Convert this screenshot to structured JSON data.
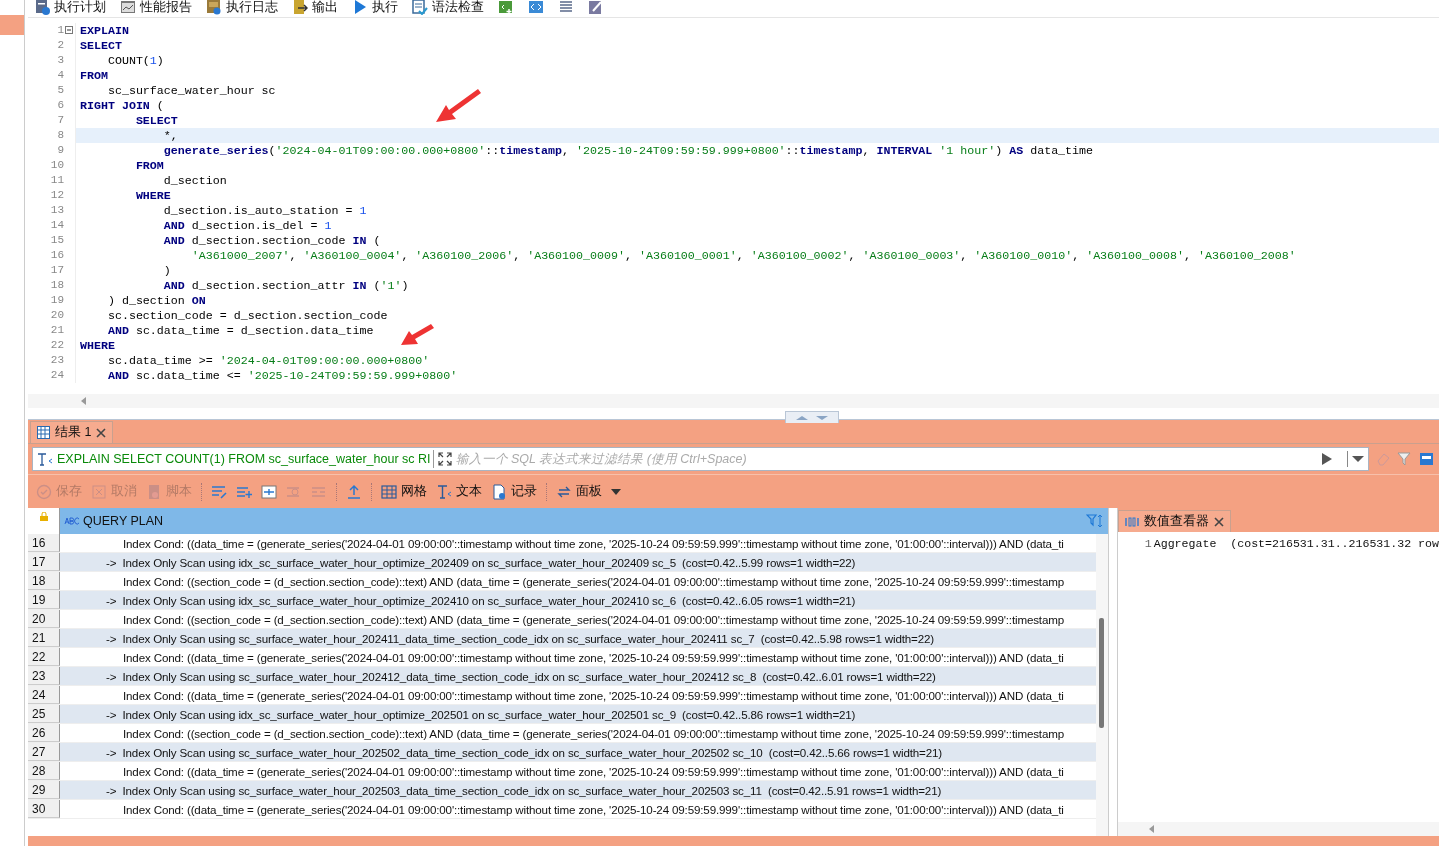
{
  "toolbar": [
    {
      "kind": "button",
      "label": "执行计划"
    },
    {
      "kind": "button",
      "label": "性能报告"
    },
    {
      "kind": "button",
      "label": "执行日志"
    },
    {
      "kind": "button",
      "label": "输出"
    },
    {
      "kind": "button",
      "label": "执行"
    },
    {
      "kind": "button",
      "label": "语法检查"
    },
    {
      "kind": "icon"
    },
    {
      "kind": "icon"
    },
    {
      "kind": "icon"
    },
    {
      "kind": "icon"
    }
  ],
  "editor": {
    "lines": [
      {
        "n": "1",
        "fold": true,
        "current": false,
        "seg": [
          {
            "kind": "keyword",
            "text": "EXPLAIN"
          }
        ]
      },
      {
        "n": "2",
        "fold": false,
        "current": false,
        "seg": [
          {
            "kind": "keyword",
            "text": "SELECT"
          }
        ]
      },
      {
        "n": "3",
        "fold": false,
        "current": false,
        "seg": [
          {
            "kind": "plain",
            "text": "    COUNT("
          },
          {
            "kind": "number",
            "text": "1"
          },
          {
            "kind": "plain",
            "text": ")"
          }
        ]
      },
      {
        "n": "4",
        "fold": false,
        "current": false,
        "seg": [
          {
            "kind": "keyword",
            "text": "FROM"
          }
        ]
      },
      {
        "n": "5",
        "fold": false,
        "current": false,
        "seg": [
          {
            "kind": "plain",
            "text": "    sc_surface_water_hour sc"
          }
        ]
      },
      {
        "n": "6",
        "fold": false,
        "current": false,
        "seg": [
          {
            "kind": "keyword",
            "text": "RIGHT JOIN"
          },
          {
            "kind": "plain",
            "text": " ("
          }
        ]
      },
      {
        "n": "7",
        "fold": false,
        "current": false,
        "seg": [
          {
            "kind": "keyword",
            "text": "        SELECT"
          }
        ]
      },
      {
        "n": "8",
        "fold": false,
        "current": true,
        "seg": [
          {
            "kind": "plain",
            "text": "            *,"
          }
        ]
      },
      {
        "n": "9",
        "fold": false,
        "current": false,
        "seg": [
          {
            "kind": "keyword",
            "text": "            generate_series"
          },
          {
            "kind": "plain",
            "text": "("
          },
          {
            "kind": "string",
            "text": "'2024-04-01T09:00:00.000+0800'"
          },
          {
            "kind": "plain",
            "text": "::"
          },
          {
            "kind": "keyword",
            "text": "timestamp"
          },
          {
            "kind": "plain",
            "text": ", "
          },
          {
            "kind": "string",
            "text": "'2025-10-24T09:59:59.999+0800'"
          },
          {
            "kind": "plain",
            "text": "::"
          },
          {
            "kind": "keyword",
            "text": "timestamp"
          },
          {
            "kind": "plain",
            "text": ", "
          },
          {
            "kind": "keyword",
            "text": "INTERVAL"
          },
          {
            "kind": "string",
            "text": " '1 hour'"
          },
          {
            "kind": "plain",
            "text": ") "
          },
          {
            "kind": "keyword",
            "text": "AS"
          },
          {
            "kind": "plain",
            "text": " data_time"
          }
        ]
      },
      {
        "n": "10",
        "fold": false,
        "current": false,
        "seg": [
          {
            "kind": "keyword",
            "text": "        FROM"
          }
        ]
      },
      {
        "n": "11",
        "fold": false,
        "current": false,
        "seg": [
          {
            "kind": "plain",
            "text": "            d_section"
          }
        ]
      },
      {
        "n": "12",
        "fold": false,
        "current": false,
        "seg": [
          {
            "kind": "keyword",
            "text": "        WHERE"
          }
        ]
      },
      {
        "n": "13",
        "fold": false,
        "current": false,
        "seg": [
          {
            "kind": "plain",
            "text": "            d_section.is_auto_station = "
          },
          {
            "kind": "number",
            "text": "1"
          }
        ]
      },
      {
        "n": "14",
        "fold": false,
        "current": false,
        "seg": [
          {
            "kind": "keyword",
            "text": "            AND"
          },
          {
            "kind": "plain",
            "text": " d_section.is_del = "
          },
          {
            "kind": "number",
            "text": "1"
          }
        ]
      },
      {
        "n": "15",
        "fold": false,
        "current": false,
        "seg": [
          {
            "kind": "keyword",
            "text": "            AND"
          },
          {
            "kind": "plain",
            "text": " d_section.section_code "
          },
          {
            "kind": "keyword",
            "text": "IN"
          },
          {
            "kind": "plain",
            "text": " ("
          }
        ]
      },
      {
        "n": "16",
        "fold": false,
        "current": false,
        "seg": [
          {
            "kind": "string",
            "text": "                'A361000_2007'"
          },
          {
            "kind": "plain",
            "text": ", "
          },
          {
            "kind": "string",
            "text": "'A360100_0004'"
          },
          {
            "kind": "plain",
            "text": ", "
          },
          {
            "kind": "string",
            "text": "'A360100_2006'"
          },
          {
            "kind": "plain",
            "text": ", "
          },
          {
            "kind": "string",
            "text": "'A360100_0009'"
          },
          {
            "kind": "plain",
            "text": ", "
          },
          {
            "kind": "string",
            "text": "'A360100_0001'"
          },
          {
            "kind": "plain",
            "text": ", "
          },
          {
            "kind": "string",
            "text": "'A360100_0002'"
          },
          {
            "kind": "plain",
            "text": ", "
          },
          {
            "kind": "string",
            "text": "'A360100_0003'"
          },
          {
            "kind": "plain",
            "text": ", "
          },
          {
            "kind": "string",
            "text": "'A360100_0010'"
          },
          {
            "kind": "plain",
            "text": ", "
          },
          {
            "kind": "string",
            "text": "'A360100_0008'"
          },
          {
            "kind": "plain",
            "text": ", "
          },
          {
            "kind": "string",
            "text": "'A360100_2008'"
          }
        ]
      },
      {
        "n": "17",
        "fold": false,
        "current": false,
        "seg": [
          {
            "kind": "plain",
            "text": "            )"
          }
        ]
      },
      {
        "n": "18",
        "fold": false,
        "current": false,
        "seg": [
          {
            "kind": "keyword",
            "text": "            AND"
          },
          {
            "kind": "plain",
            "text": " d_section.section_attr "
          },
          {
            "kind": "keyword",
            "text": "IN"
          },
          {
            "kind": "plain",
            "text": " ("
          },
          {
            "kind": "string",
            "text": "'1'"
          },
          {
            "kind": "plain",
            "text": ")"
          }
        ]
      },
      {
        "n": "19",
        "fold": false,
        "current": false,
        "seg": [
          {
            "kind": "plain",
            "text": "    ) d_section "
          },
          {
            "kind": "keyword",
            "text": "ON"
          }
        ]
      },
      {
        "n": "20",
        "fold": false,
        "current": false,
        "seg": [
          {
            "kind": "plain",
            "text": "    sc.section_code = d_section.section_code"
          }
        ]
      },
      {
        "n": "21",
        "fold": false,
        "current": false,
        "seg": [
          {
            "kind": "keyword",
            "text": "    AND"
          },
          {
            "kind": "plain",
            "text": " sc.data_time = d_section.data_time"
          }
        ]
      },
      {
        "n": "22",
        "fold": false,
        "current": false,
        "seg": [
          {
            "kind": "keyword",
            "text": "WHERE"
          }
        ]
      },
      {
        "n": "23",
        "fold": false,
        "current": false,
        "seg": [
          {
            "kind": "plain",
            "text": "    sc.data_time >= "
          },
          {
            "kind": "string",
            "text": "'2024-04-01T09:00:00.000+0800'"
          }
        ]
      },
      {
        "n": "24",
        "fold": false,
        "current": false,
        "seg": [
          {
            "kind": "keyword",
            "text": "    AND"
          },
          {
            "kind": "plain",
            "text": " sc.data_time <= "
          },
          {
            "kind": "string",
            "text": "'2025-10-24T09:59:59.999+0800'"
          }
        ]
      }
    ]
  },
  "results": {
    "tab": {
      "label": "结果 1",
      "selected": true
    },
    "filter": {
      "query": "EXPLAIN SELECT COUNT(1) FROM sc_surface_water_hour sc RI",
      "placeholder": "输入一个 SQL 表达式来过滤结果 (使用 Ctrl+Space)"
    },
    "toolbar": [
      {
        "kind": "button",
        "label": "保存",
        "disabled": true
      },
      {
        "kind": "button",
        "label": "取消",
        "disabled": true
      },
      {
        "kind": "button",
        "label": "脚本",
        "disabled": true
      },
      {
        "kind": "sep"
      },
      {
        "kind": "button",
        "disabled": false
      },
      {
        "kind": "button",
        "disabled": false
      },
      {
        "kind": "button",
        "disabled": false
      },
      {
        "kind": "button",
        "disabled": true
      },
      {
        "kind": "button",
        "disabled": true
      },
      {
        "kind": "sep"
      },
      {
        "kind": "button",
        "disabled": false
      },
      {
        "kind": "sep"
      },
      {
        "kind": "button",
        "label": "网格",
        "disabled": false
      },
      {
        "kind": "button",
        "label": "文本",
        "disabled": false
      },
      {
        "kind": "button",
        "label": "记录",
        "disabled": false
      },
      {
        "kind": "sep"
      },
      {
        "kind": "button",
        "label": "面板",
        "disabled": false
      },
      {
        "kind": "caret"
      }
    ],
    "column": "QUERY PLAN",
    "rows": [
      {
        "n": "16",
        "kind": "cond",
        "text": "Index Cond: ((data_time = (generate_series('2024-04-01 09:00:00'::timestamp without time zone, '2025-10-24 09:59:59.999'::timestamp without time zone, '01:00:00'::interval))) AND (data_ti"
      },
      {
        "n": "17",
        "kind": "node",
        "text": "->  Index Only Scan using idx_sc_surface_water_hour_optimize_202409 on sc_surface_water_hour_202409 sc_5  (cost=0.42..5.99 rows=1 width=22)"
      },
      {
        "n": "18",
        "kind": "cond",
        "text": "Index Cond: ((section_code = (d_section.section_code)::text) AND (data_time = (generate_series('2024-04-01 09:00:00'::timestamp without time zone, '2025-10-24 09:59:59.999'::timestamp"
      },
      {
        "n": "19",
        "kind": "node",
        "text": "->  Index Only Scan using idx_sc_surface_water_hour_optimize_202410 on sc_surface_water_hour_202410 sc_6  (cost=0.42..6.05 rows=1 width=21)"
      },
      {
        "n": "20",
        "kind": "cond",
        "text": "Index Cond: ((section_code = (d_section.section_code)::text) AND (data_time = (generate_series('2024-04-01 09:00:00'::timestamp without time zone, '2025-10-24 09:59:59.999'::timestamp"
      },
      {
        "n": "21",
        "kind": "node",
        "text": "->  Index Only Scan using sc_surface_water_hour_202411_data_time_section_code_idx on sc_surface_water_hour_202411 sc_7  (cost=0.42..5.98 rows=1 width=22)"
      },
      {
        "n": "22",
        "kind": "cond",
        "text": "Index Cond: ((data_time = (generate_series('2024-04-01 09:00:00'::timestamp without time zone, '2025-10-24 09:59:59.999'::timestamp without time zone, '01:00:00'::interval))) AND (data_ti"
      },
      {
        "n": "23",
        "kind": "node",
        "text": "->  Index Only Scan using sc_surface_water_hour_202412_data_time_section_code_idx on sc_surface_water_hour_202412 sc_8  (cost=0.42..6.01 rows=1 width=22)"
      },
      {
        "n": "24",
        "kind": "cond",
        "text": "Index Cond: ((data_time = (generate_series('2024-04-01 09:00:00'::timestamp without time zone, '2025-10-24 09:59:59.999'::timestamp without time zone, '01:00:00'::interval))) AND (data_ti"
      },
      {
        "n": "25",
        "kind": "node",
        "text": "->  Index Only Scan using idx_sc_surface_water_hour_optimize_202501 on sc_surface_water_hour_202501 sc_9  (cost=0.42..5.86 rows=1 width=21)"
      },
      {
        "n": "26",
        "kind": "cond",
        "text": "Index Cond: ((section_code = (d_section.section_code)::text) AND (data_time = (generate_series('2024-04-01 09:00:00'::timestamp without time zone, '2025-10-24 09:59:59.999'::timestamp"
      },
      {
        "n": "27",
        "kind": "node",
        "text": "->  Index Only Scan using sc_surface_water_hour_202502_data_time_section_code_idx on sc_surface_water_hour_202502 sc_10  (cost=0.42..5.66 rows=1 width=21)"
      },
      {
        "n": "28",
        "kind": "cond",
        "text": "Index Cond: ((data_time = (generate_series('2024-04-01 09:00:00'::timestamp without time zone, '2025-10-24 09:59:59.999'::timestamp without time zone, '01:00:00'::interval))) AND (data_ti"
      },
      {
        "n": "29",
        "kind": "node",
        "text": "->  Index Only Scan using sc_surface_water_hour_202503_data_time_section_code_idx on sc_surface_water_hour_202503 sc_11  (cost=0.42..5.91 rows=1 width=21)"
      },
      {
        "n": "30",
        "kind": "cond",
        "text": "Index Cond: ((data_time = (generate_series('2024-04-01 09:00:00'::timestamp without time zone, '2025-10-24 09:59:59.999'::timestamp without time zone, '01:00:00'::interval))) AND (data_ti"
      }
    ]
  },
  "viewer": {
    "tab": {
      "label": "数值查看器",
      "selected": true
    },
    "lines": [
      {
        "n": "1",
        "text": "Aggregate  (cost=216531.31..216531.32 row"
      }
    ]
  }
}
